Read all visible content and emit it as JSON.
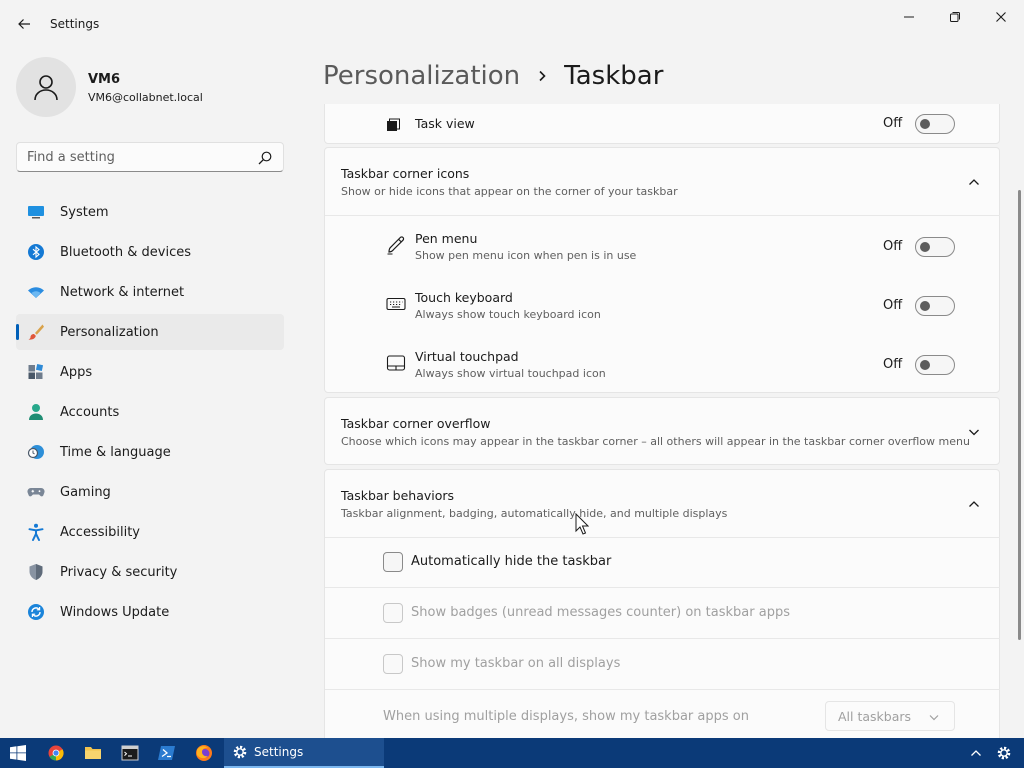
{
  "window": {
    "title": "Settings",
    "back_icon": "arrow-left-icon",
    "minimize_icon": "minimize-icon",
    "maximize_icon": "restore-icon",
    "close_icon": "close-icon"
  },
  "profile": {
    "name": "VM6",
    "email": "VM6@collabnet.local",
    "avatar_icon": "user-icon"
  },
  "search": {
    "placeholder": "Find a setting",
    "icon": "search-icon"
  },
  "sidebar": {
    "items": [
      {
        "label": "System",
        "icon": "monitor-icon",
        "active": false
      },
      {
        "label": "Bluetooth & devices",
        "icon": "bluetooth-icon",
        "active": false
      },
      {
        "label": "Network & internet",
        "icon": "wifi-icon",
        "active": false
      },
      {
        "label": "Personalization",
        "icon": "brush-icon",
        "active": true
      },
      {
        "label": "Apps",
        "icon": "apps-icon",
        "active": false
      },
      {
        "label": "Accounts",
        "icon": "person-icon",
        "active": false
      },
      {
        "label": "Time & language",
        "icon": "clock-globe-icon",
        "active": false
      },
      {
        "label": "Gaming",
        "icon": "gamepad-icon",
        "active": false
      },
      {
        "label": "Accessibility",
        "icon": "accessibility-icon",
        "active": false
      },
      {
        "label": "Privacy & security",
        "icon": "shield-icon",
        "active": false
      },
      {
        "label": "Windows Update",
        "icon": "update-icon",
        "active": false
      }
    ]
  },
  "header": {
    "parent": "Personalization",
    "current": "Taskbar"
  },
  "task_view": {
    "label": "Task view",
    "state": "Off",
    "icon": "task-view-icon"
  },
  "corner_icons": {
    "title": "Taskbar corner icons",
    "subtitle": "Show or hide icons that appear on the corner of your taskbar",
    "expanded": true,
    "rows": [
      {
        "title": "Pen menu",
        "subtitle": "Show pen menu icon when pen is in use",
        "state": "Off",
        "icon": "pen-icon"
      },
      {
        "title": "Touch keyboard",
        "subtitle": "Always show touch keyboard icon",
        "state": "Off",
        "icon": "keyboard-icon"
      },
      {
        "title": "Virtual touchpad",
        "subtitle": "Always show virtual touchpad icon",
        "state": "Off",
        "icon": "touchpad-icon"
      }
    ]
  },
  "corner_overflow": {
    "title": "Taskbar corner overflow",
    "subtitle": "Choose which icons may appear in the taskbar corner – all others will appear in the taskbar corner overflow menu",
    "expanded": false
  },
  "behaviors": {
    "title": "Taskbar behaviors",
    "subtitle": "Taskbar alignment, badging, automatically hide, and multiple displays",
    "expanded": true,
    "options": [
      {
        "label": "Automatically hide the taskbar",
        "checked": false,
        "enabled": true
      },
      {
        "label": "Show badges (unread messages counter) on taskbar apps",
        "checked": false,
        "enabled": false
      },
      {
        "label": "Show my taskbar on all displays",
        "checked": false,
        "enabled": false
      }
    ],
    "multi_display": {
      "label": "When using multiple displays, show my taskbar apps on",
      "value": "All taskbars"
    }
  },
  "taskbar": {
    "apps": [
      "windows-start-icon",
      "chrome-icon",
      "file-explorer-icon",
      "terminal-icon",
      "powershell-icon",
      "firefox-icon"
    ],
    "active_app": {
      "label": "Settings",
      "icon": "settings-gear-icon"
    },
    "tray": [
      "chevron-up-icon",
      "settings-gear-icon"
    ]
  },
  "colors": {
    "accent": "#005fb8",
    "taskbar": "#0b3a78"
  }
}
